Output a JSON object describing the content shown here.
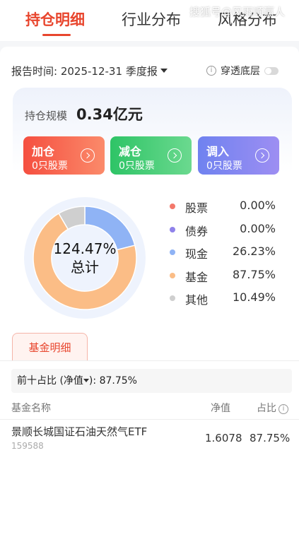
{
  "tabs": [
    {
      "label": "持仓明细",
      "active": true
    },
    {
      "label": "行业分布",
      "active": false
    },
    {
      "label": "风格分布",
      "active": false
    }
  ],
  "watermark": "搜狐号@风雨顺赢人",
  "report": {
    "label": "报告时间:",
    "date": "2025-12-31",
    "period": "季度报",
    "penetrate_label": "穿透底层",
    "penetrate_on": false
  },
  "summary": {
    "scale_label": "持仓规模",
    "scale_value": "0.34亿元"
  },
  "actions": [
    {
      "title": "加仓",
      "subtitle": "0只股票",
      "color": "#f76a4f"
    },
    {
      "title": "减仓",
      "subtitle": "0只股票",
      "color": "#3fcb78"
    },
    {
      "title": "调入",
      "subtitle": "0只股票",
      "color": "#7b8af2"
    }
  ],
  "chart_data": {
    "type": "pie",
    "center_value": "124.47%",
    "center_label": "总计",
    "slices": [
      {
        "name": "股票",
        "value": 0.0,
        "label": "0.00%",
        "color": "#f3786b"
      },
      {
        "name": "债券",
        "value": 0.0,
        "label": "0.00%",
        "color": "#8f82ea"
      },
      {
        "name": "现金",
        "value": 26.23,
        "label": "26.23%",
        "color": "#8fb3f5"
      },
      {
        "name": "基金",
        "value": 87.75,
        "label": "87.75%",
        "color": "#fbbd86"
      },
      {
        "name": "其他",
        "value": 10.49,
        "label": "10.49%",
        "color": "#cfcfcf"
      }
    ]
  },
  "detail_tab": "基金明细",
  "top10": {
    "label": "前十占比",
    "basis": "(净值",
    "basis_close": ")",
    "colon": ":",
    "value": "87.75%"
  },
  "table": {
    "headers": {
      "name": "基金名称",
      "nav": "净值",
      "ratio": "占比"
    },
    "rows": [
      {
        "name": "景顺长城国证石油天然气ETF",
        "code": "159588",
        "nav": "1.6078",
        "ratio": "87.75%"
      }
    ]
  }
}
